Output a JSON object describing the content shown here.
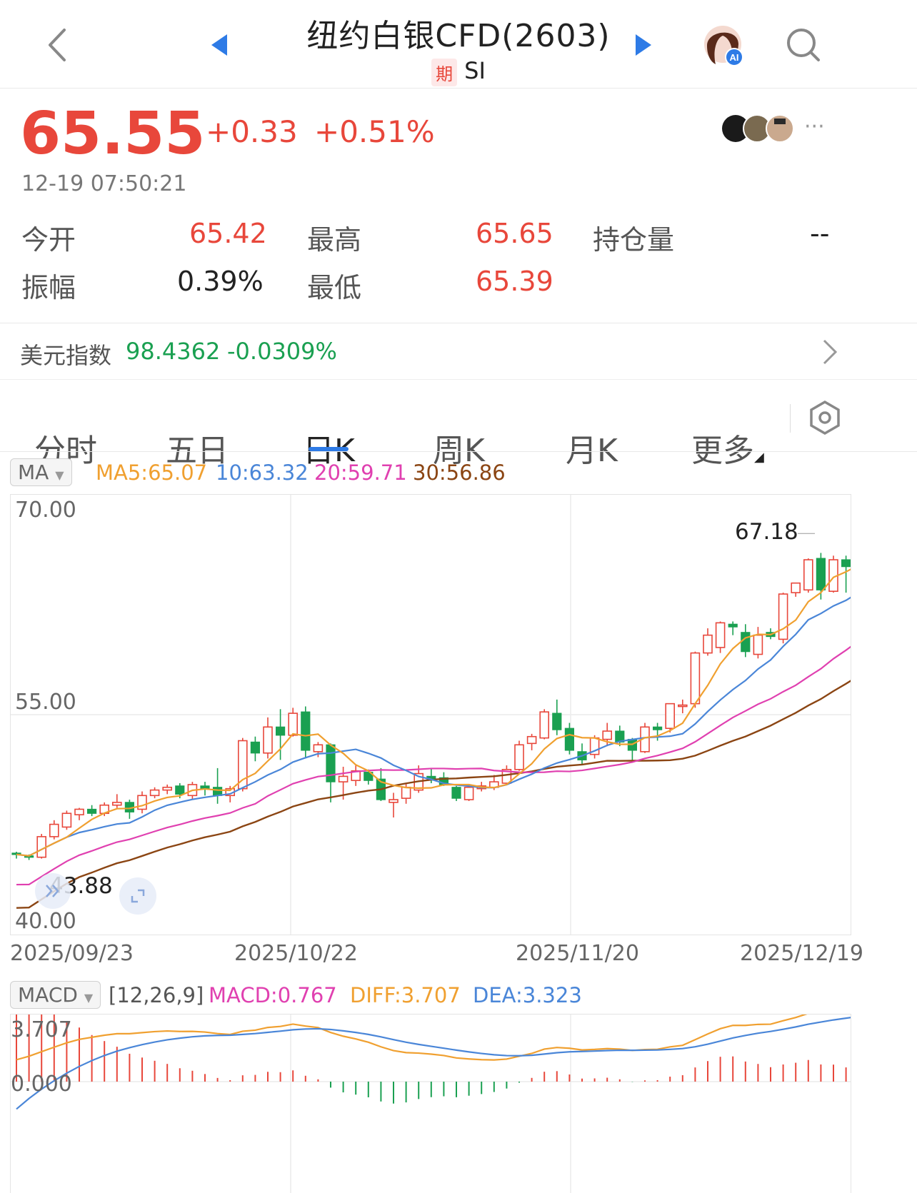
{
  "header": {
    "title": "纽约白银CFD(2603)",
    "badge": "期",
    "symbol": "SI"
  },
  "quote": {
    "price": "65.55",
    "change": "+0.33",
    "change_pct": "+0.51%",
    "time": "12-19 07:50:21",
    "more": "···"
  },
  "stats": {
    "open_label": "今开",
    "open_value": "65.42",
    "high_label": "最高",
    "high_value": "65.65",
    "oi_label": "持仓量",
    "oi_value": "--",
    "amp_label": "振幅",
    "amp_value": "0.39%",
    "low_label": "最低",
    "low_value": "65.39"
  },
  "dxy": {
    "label": "美元指数",
    "value": "98.4362",
    "change": "-0.0309%"
  },
  "tabs": [
    {
      "label": "分时"
    },
    {
      "label": "五日"
    },
    {
      "label": "日K"
    },
    {
      "label": "周K"
    },
    {
      "label": "月K"
    },
    {
      "label": "更多"
    }
  ],
  "colors": {
    "up": "#e8473b",
    "down": "#1aa051",
    "ma5": "#f0a030",
    "ma10": "#4a86d8",
    "ma20": "#e040b0",
    "ma30": "#8b4513",
    "accent": "#2e7be6"
  },
  "ma_bar": {
    "selector": "MA",
    "ma5": "MA5:65.07",
    "ma10": "10:63.32",
    "ma20": "20:59.71",
    "ma30": "30:56.86"
  },
  "kline": {
    "y_labels": [
      "70.00",
      "55.00",
      "40.00"
    ],
    "max_label": "67.18",
    "min_label": "43.88",
    "dates": [
      "2025/09/23",
      "2025/10/22",
      "2025/11/20",
      "2025/12/19"
    ]
  },
  "macd_bar": {
    "selector": "MACD",
    "params": "[12,26,9]",
    "macd": "MACD:0.767",
    "diff": "DIFF:3.707",
    "dea": "DEA:3.323"
  },
  "macd_chart": {
    "top_label": "3.707",
    "zero_label": "0.000"
  },
  "chart_data": {
    "type": "candlestick",
    "y_range": [
      40,
      70
    ],
    "x_dates": [
      "2025/09/23",
      "2025/10/22",
      "2025/11/20",
      "2025/12/19"
    ],
    "candles": [
      [
        44.9,
        45.0,
        44.5,
        44.8
      ],
      [
        44.7,
        44.8,
        44.4,
        44.6
      ],
      [
        44.6,
        46.3,
        44.5,
        46.1
      ],
      [
        46.1,
        47.3,
        45.9,
        47.0
      ],
      [
        46.8,
        48.0,
        46.6,
        47.8
      ],
      [
        47.7,
        48.2,
        47.3,
        48.1
      ],
      [
        48.1,
        48.4,
        47.6,
        47.8
      ],
      [
        47.8,
        48.6,
        47.6,
        48.4
      ],
      [
        48.4,
        49.2,
        48.2,
        48.6
      ],
      [
        48.6,
        48.8,
        47.4,
        47.9
      ],
      [
        48.1,
        49.4,
        47.8,
        49.1
      ],
      [
        49.1,
        49.7,
        48.9,
        49.5
      ],
      [
        49.5,
        49.9,
        49.2,
        49.7
      ],
      [
        49.8,
        50.0,
        48.9,
        49.2
      ],
      [
        49.1,
        50.1,
        48.8,
        49.9
      ],
      [
        49.8,
        50.1,
        49.1,
        49.6
      ],
      [
        49.7,
        51.1,
        48.5,
        49.1
      ],
      [
        49.1,
        49.8,
        48.6,
        49.6
      ],
      [
        49.6,
        53.3,
        49.4,
        53.1
      ],
      [
        53.0,
        53.4,
        51.6,
        52.2
      ],
      [
        52.2,
        54.8,
        51.8,
        54.1
      ],
      [
        54.1,
        55.4,
        51.7,
        53.5
      ],
      [
        53.5,
        55.5,
        53.4,
        55.1
      ],
      [
        55.2,
        55.6,
        51.8,
        52.4
      ],
      [
        52.3,
        53.0,
        51.9,
        52.8
      ],
      [
        52.8,
        52.9,
        48.6,
        50.1
      ],
      [
        50.1,
        51.2,
        48.8,
        50.5
      ],
      [
        50.2,
        51.3,
        49.8,
        50.9
      ],
      [
        50.8,
        51.0,
        49.9,
        50.2
      ],
      [
        50.3,
        51.1,
        48.7,
        48.8
      ],
      [
        48.6,
        49.3,
        47.5,
        48.8
      ],
      [
        48.9,
        50.0,
        48.5,
        49.7
      ],
      [
        49.5,
        51.3,
        49.3,
        50.7
      ],
      [
        50.5,
        51.1,
        50.0,
        50.3
      ],
      [
        50.4,
        50.8,
        49.8,
        49.9
      ],
      [
        49.7,
        49.8,
        48.7,
        48.9
      ],
      [
        48.8,
        49.8,
        48.7,
        49.7
      ],
      [
        49.6,
        50.1,
        49.4,
        49.8
      ],
      [
        49.7,
        50.6,
        49.5,
        50.1
      ],
      [
        50.0,
        51.3,
        49.9,
        51.0
      ],
      [
        51.0,
        53.1,
        50.9,
        52.8
      ],
      [
        52.9,
        53.6,
        52.4,
        53.4
      ],
      [
        53.3,
        55.4,
        53.2,
        55.2
      ],
      [
        55.1,
        56.1,
        53.5,
        53.9
      ],
      [
        54.0,
        54.4,
        52.1,
        52.4
      ],
      [
        52.3,
        52.9,
        51.4,
        51.7
      ],
      [
        52.1,
        53.5,
        51.8,
        53.3
      ],
      [
        53.2,
        54.4,
        52.7,
        53.8
      ],
      [
        53.8,
        54.2,
        52.7,
        53.0
      ],
      [
        53.2,
        53.3,
        51.5,
        52.4
      ],
      [
        52.3,
        54.4,
        52.2,
        54.1
      ],
      [
        54.1,
        54.4,
        53.1,
        53.9
      ],
      [
        54.0,
        55.8,
        53.7,
        55.8
      ],
      [
        55.6,
        56.1,
        55.1,
        55.7
      ],
      [
        55.8,
        59.6,
        55.5,
        59.5
      ],
      [
        59.5,
        61.3,
        59.3,
        60.8
      ],
      [
        59.9,
        61.8,
        59.5,
        61.7
      ],
      [
        61.6,
        61.8,
        60.8,
        61.4
      ],
      [
        61.0,
        61.6,
        59.2,
        59.6
      ],
      [
        59.4,
        61.4,
        59.1,
        60.8
      ],
      [
        61.0,
        61.3,
        60.5,
        60.7
      ],
      [
        60.5,
        63.9,
        60.2,
        63.8
      ],
      [
        63.9,
        64.6,
        63.6,
        64.6
      ],
      [
        64.1,
        66.4,
        63.9,
        66.3
      ],
      [
        66.4,
        66.8,
        63.4,
        64.1
      ],
      [
        64.0,
        66.6,
        63.9,
        66.3
      ],
      [
        66.3,
        66.6,
        63.9,
        65.8
      ],
      [
        65.7,
        67.8,
        65.3,
        67.1
      ],
      [
        67.2,
        67.5,
        65.4,
        65.9
      ],
      [
        65.42,
        65.65,
        65.39,
        65.55
      ]
    ]
  }
}
